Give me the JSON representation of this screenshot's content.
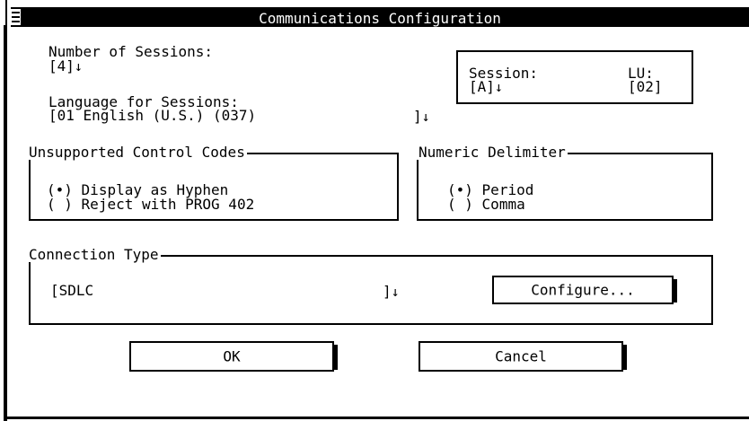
{
  "window": {
    "title": "Communications Configuration",
    "system_menu_icon": "system-menu-icon"
  },
  "sessions": {
    "label": "Number of Sessions:",
    "value": "[4]",
    "arrow": "↓"
  },
  "session_lu": {
    "session_label": "Session:",
    "session_value": "[A]",
    "session_arrow": "↓",
    "lu_label": "LU:",
    "lu_value": "[02]"
  },
  "language": {
    "label": "Language for Sessions:",
    "value": "[01 English (U.S.) (037)",
    "close": "]",
    "arrow": "↓"
  },
  "control_codes": {
    "group_label": "Unsupported Control Codes",
    "options": [
      {
        "marker": "(•)",
        "label": "Display as Hyphen",
        "selected": true
      },
      {
        "marker": "( )",
        "label": "Reject with PROG 402",
        "selected": false
      }
    ]
  },
  "delimiter": {
    "group_label": "Numeric Delimiter",
    "options": [
      {
        "marker": "(•)",
        "label": "Period",
        "selected": true
      },
      {
        "marker": "( )",
        "label": "Comma",
        "selected": false
      }
    ]
  },
  "connection": {
    "group_label": "Connection Type",
    "value": "[SDLC",
    "close": "]",
    "arrow": "↓",
    "configure_label": "Configure..."
  },
  "buttons": {
    "ok_label": "OK",
    "cancel_label": "Cancel"
  }
}
